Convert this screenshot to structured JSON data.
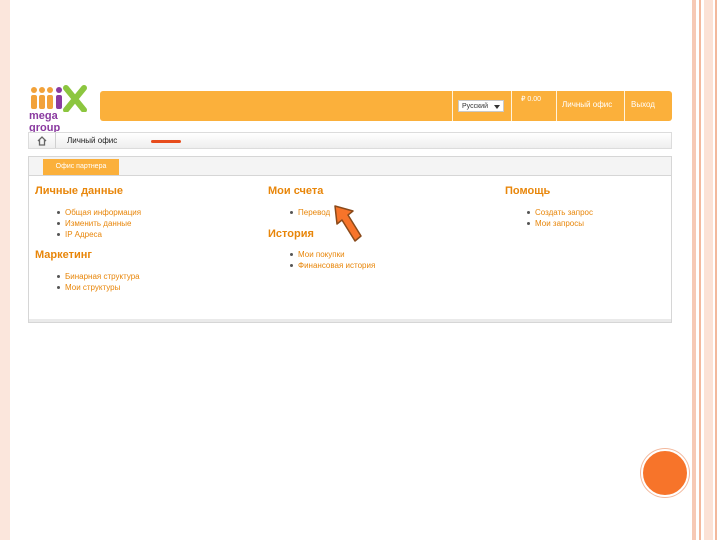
{
  "logo": {
    "wordmark": "mix",
    "subtitle": "mega group"
  },
  "topbar": {
    "language": "Русский",
    "balance": "₽ 0.00",
    "office_link": "Личный офис",
    "logout_link": "Выход"
  },
  "breadcrumb": {
    "current": "Личный офис"
  },
  "tabs": [
    {
      "label": "Офис партнера"
    }
  ],
  "sections": {
    "personal": {
      "title": "Личные данные",
      "items": [
        "Общая информация",
        "Изменить данные",
        "IP Адреса"
      ]
    },
    "marketing": {
      "title": "Маркетинг",
      "items": [
        "Бинарная структура",
        "Мои структуры"
      ]
    },
    "accounts": {
      "title": "Мои счета",
      "items": [
        "Перевод"
      ]
    },
    "history": {
      "title": "История",
      "items": [
        "Мои покупки",
        "Финансовая история"
      ]
    },
    "help": {
      "title": "Помощь",
      "items": [
        "Создать запрос",
        "Мои запросы"
      ]
    }
  },
  "colors": {
    "accent": "#fbb03b",
    "link": "#e8860a",
    "highlight": "#f7742a"
  }
}
